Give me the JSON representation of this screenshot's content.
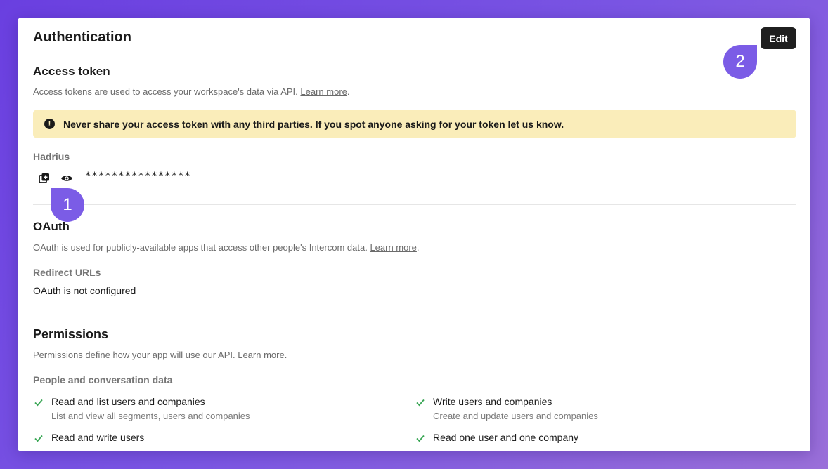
{
  "header": {
    "title": "Authentication",
    "edit_label": "Edit"
  },
  "access_token": {
    "heading": "Access token",
    "description": "Access tokens are used to access your workspace's data via API.",
    "learn_more": "Learn more",
    "period": ".",
    "warning": "Never share your access token with any third parties. If you spot anyone asking for your token let us know.",
    "warning_icon_glyph": "!",
    "name": "Hadrius",
    "masked_value": "****************"
  },
  "oauth": {
    "heading": "OAuth",
    "description": "OAuth is used for publicly-available apps that access other people's Intercom data.",
    "learn_more": "Learn more",
    "period": ".",
    "redirect_label": "Redirect URLs",
    "redirect_value": "OAuth is not configured"
  },
  "permissions": {
    "heading": "Permissions",
    "description": "Permissions define how your app will use our API.",
    "learn_more": "Learn more",
    "period": ".",
    "group_label": "People and conversation data",
    "items": [
      {
        "title": "Read and list users and companies",
        "subtitle": "List and view all segments, users and companies"
      },
      {
        "title": "Write users and companies",
        "subtitle": "Create and update users and companies"
      },
      {
        "title": "Read and write users",
        "subtitle": ""
      },
      {
        "title": "Read one user and one company",
        "subtitle": ""
      }
    ]
  },
  "markers": {
    "one": "1",
    "two": "2"
  },
  "icons": {
    "copy": "copy-icon",
    "view": "eye-icon",
    "check": "check-icon",
    "warning": "warning-icon"
  },
  "colors": {
    "accent": "#7b5ce6",
    "warning_bg": "#faedba",
    "check": "#3aa655",
    "button": "#1f1f1f"
  }
}
